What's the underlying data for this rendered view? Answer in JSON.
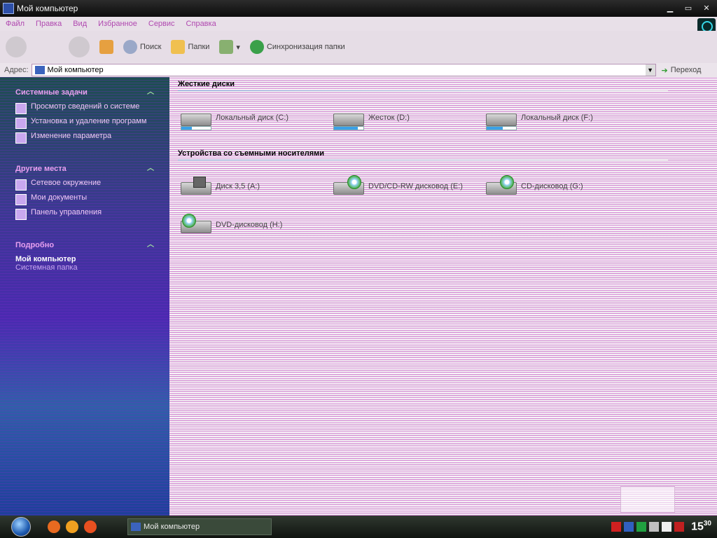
{
  "window": {
    "title": "Мой компьютер"
  },
  "menu": [
    "Файл",
    "Правка",
    "Вид",
    "Избранное",
    "Сервис",
    "Справка"
  ],
  "toolbar": {
    "search_label": "Поиск",
    "folders_label": "Папки",
    "sync_label": "Синхронизация папки"
  },
  "address": {
    "label": "Адрес:",
    "value": "Мой компьютер",
    "go_label": "Переход"
  },
  "left_pane": {
    "system_tasks": {
      "header": "Системные задачи",
      "items": [
        {
          "label": "Просмотр сведений о системе",
          "icon": "info-icon"
        },
        {
          "label": "Установка и удаление программ",
          "icon": "programs-icon"
        },
        {
          "label": "Изменение параметра",
          "icon": "control-panel-icon"
        }
      ]
    },
    "other_places": {
      "header": "Другие места",
      "items": [
        {
          "label": "Сетевое окружение",
          "icon": "network-icon"
        },
        {
          "label": "Мои документы",
          "icon": "documents-icon"
        },
        {
          "label": "Панель управления",
          "icon": "control-panel-icon"
        }
      ]
    },
    "details": {
      "header": "Подробно",
      "title": "Мой компьютер",
      "subtitle": "Системная папка"
    }
  },
  "content": {
    "hard_drives": {
      "header": "Жесткие диски",
      "items": [
        {
          "label": "Локальный диск (C:)",
          "usage": 0.35
        },
        {
          "label": "Жесток (D:)",
          "usage": 0.8
        },
        {
          "label": "Локальный диск (F:)",
          "usage": 0.55
        }
      ]
    },
    "removable": {
      "header": "Устройства со съемными носителями",
      "items": [
        {
          "label": "Диск 3,5 (A:)",
          "type": "floppy"
        },
        {
          "label": "DVD/CD-RW дисковод (E:)",
          "type": "dvd"
        },
        {
          "label": "CD-дисковод (G:)",
          "type": "cd"
        },
        {
          "label": "DVD-дисковод (H:)",
          "type": "dvd"
        }
      ]
    }
  },
  "taskbar": {
    "window_button": "Мой компьютер",
    "clock": "15",
    "clock_minutes": "30"
  },
  "colors": {
    "left_pane_header": "#e8a0f0",
    "stripe_magenta": "#be3cbe"
  }
}
